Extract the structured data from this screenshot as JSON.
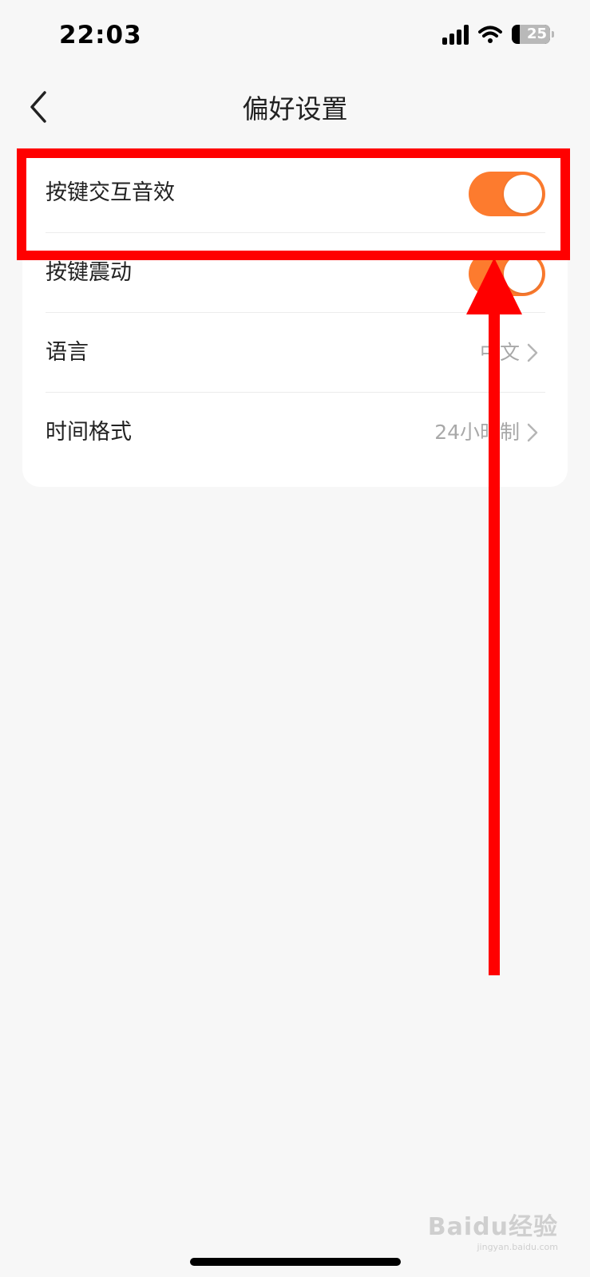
{
  "status_bar": {
    "time": "22:03",
    "battery_level": "25",
    "icons": [
      "signal-icon",
      "wifi-icon",
      "battery-icon"
    ]
  },
  "nav": {
    "title": "偏好设置",
    "back_icon": "chevron-left-icon"
  },
  "settings": {
    "key_sound": {
      "label": "按键交互音效",
      "enabled": true
    },
    "key_vibration": {
      "label": "按键震动",
      "enabled": true
    },
    "language": {
      "label": "语言",
      "value": "中文"
    },
    "time_format": {
      "label": "时间格式",
      "value": "24小时制"
    }
  },
  "watermark": {
    "logo": "Baidu经验",
    "url": "jingyan.baidu.com"
  },
  "colors": {
    "accent": "#fd7b2e",
    "annotation": "#ff0000",
    "background": "#f7f7f7",
    "card": "#ffffff",
    "value_text": "#a8a8a8"
  }
}
